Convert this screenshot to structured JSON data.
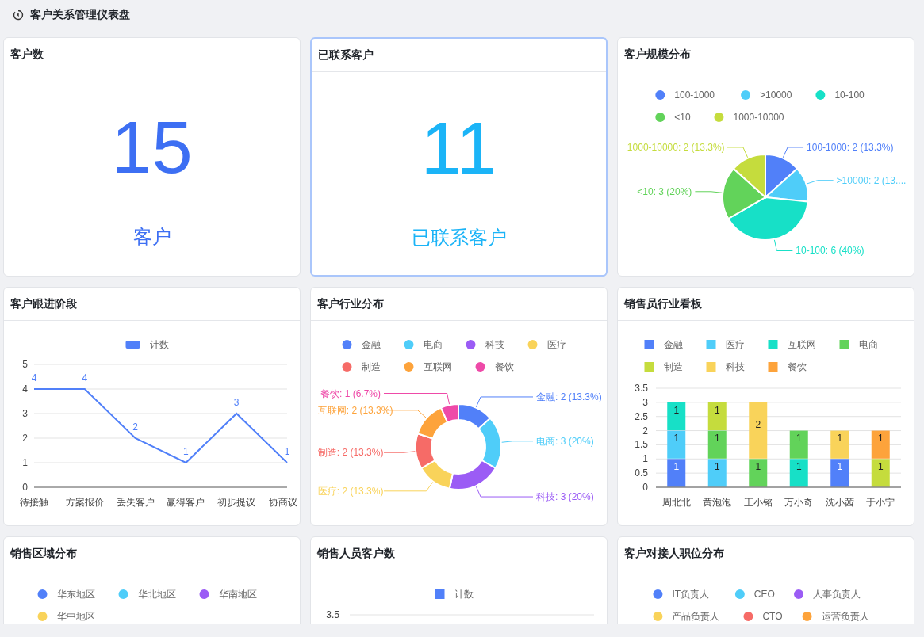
{
  "header": {
    "title": "客户关系管理仪表盘"
  },
  "cards": [
    {
      "kind": "stat",
      "title": "客户数",
      "value": "15",
      "label": "客户",
      "color": "#3d6ff3",
      "highlighted": false
    },
    {
      "kind": "stat",
      "title": "已联系客户",
      "value": "11",
      "label": "已联系客户",
      "color": "#1bb4f7",
      "highlighted": true
    },
    {
      "kind": "chart",
      "title": "客户规模分布",
      "chart_data": {
        "type": "pie",
        "legend": "top",
        "categories": [
          "100-1000",
          ">10000",
          "10-100",
          "<10",
          "1000-10000"
        ],
        "values": [
          2,
          2,
          6,
          3,
          2
        ],
        "colors": [
          "#5180f9",
          "#4fcdf9",
          "#17e0c7",
          "#62d35a",
          "#c5dc3d"
        ],
        "value_labels": [
          "100-1000: 2 (13.3%)",
          ">10000: 2 (13....",
          "10-100: 6 (40%)",
          "<10: 3 (20%)",
          "1000-10000: 2 (13.3%)"
        ]
      }
    },
    {
      "kind": "chart",
      "title": "客户跟进阶段",
      "chart_data": {
        "type": "line",
        "legend": "top",
        "grid": true,
        "categories": [
          "待接触",
          "方案报价",
          "丢失客户",
          "赢得客户",
          "初步提议",
          "协商议"
        ],
        "series": [
          {
            "name": "计数",
            "color": "#5180f9",
            "values": [
              4,
              4,
              2,
              1,
              3,
              1
            ]
          }
        ],
        "ylim": [
          0,
          5
        ],
        "yticks": [
          0,
          1,
          2,
          3,
          4,
          5
        ],
        "data_labels": true
      }
    },
    {
      "kind": "chart",
      "title": "客户行业分布",
      "chart_data": {
        "type": "donut",
        "legend": "top",
        "categories": [
          "金融",
          "电商",
          "科技",
          "医疗",
          "制造",
          "互联网",
          "餐饮"
        ],
        "values": [
          2,
          3,
          3,
          2,
          2,
          2,
          1
        ],
        "colors": [
          "#5180f9",
          "#4fcdf9",
          "#9b5cf5",
          "#f9d35a",
          "#f66b67",
          "#fda33b",
          "#ee4aa8"
        ],
        "value_labels": [
          "金融: 2 (13.3%)",
          "电商: 3 (20%)",
          "科技: 3 (20%)",
          "医疗: 2 (13.3%)",
          "制造: 2 (13.3%)",
          "互联网: 2 (13.3%)",
          "餐饮: 1 (6.7%)"
        ]
      }
    },
    {
      "kind": "chart",
      "title": "销售员行业看板",
      "chart_data": {
        "type": "bar",
        "legend": "top",
        "grid": true,
        "stacked": true,
        "categories": [
          "周北北",
          "黄泡泡",
          "王小铭",
          "万小奇",
          "沈小茜",
          "于小宁"
        ],
        "series": [
          {
            "name": "金融",
            "color": "#5180f9",
            "values": [
              1,
              null,
              null,
              null,
              1,
              null
            ]
          },
          {
            "name": "医疗",
            "color": "#4fcdf9",
            "values": [
              1,
              1,
              null,
              null,
              null,
              null
            ]
          },
          {
            "name": "互联网",
            "color": "#17e0c7",
            "values": [
              1,
              null,
              null,
              1,
              null,
              null
            ]
          },
          {
            "name": "电商",
            "color": "#62d35a",
            "values": [
              null,
              1,
              1,
              1,
              null,
              null
            ]
          },
          {
            "name": "制造",
            "color": "#c5dc3d",
            "values": [
              null,
              1,
              null,
              null,
              null,
              1
            ]
          },
          {
            "name": "科技",
            "color": "#f9d35a",
            "values": [
              null,
              null,
              2,
              null,
              1,
              null
            ]
          },
          {
            "name": "餐饮",
            "color": "#fda33b",
            "values": [
              null,
              null,
              null,
              null,
              null,
              1
            ]
          }
        ],
        "ylim": [
          0,
          3.5
        ],
        "yticks": [
          0,
          0.5,
          1,
          1.5,
          2,
          2.5,
          3,
          3.5
        ],
        "data_labels": true
      }
    },
    {
      "kind": "dot_legend",
      "title": "销售区域分布",
      "legend": [
        {
          "label": "华东地区",
          "color": "#5180f9"
        },
        {
          "label": "华北地区",
          "color": "#4fcdf9"
        },
        {
          "label": "华南地区",
          "color": "#9b5cf5"
        },
        {
          "label": "华中地区",
          "color": "#f9d35a"
        }
      ]
    },
    {
      "kind": "square_legend",
      "title": "销售人员客户数",
      "legend": [
        {
          "label": "计数",
          "color": "#5180f9"
        }
      ],
      "axis_labels": [
        "3.5"
      ]
    },
    {
      "kind": "dot_legend",
      "title": "客户对接人职位分布",
      "legend": [
        {
          "label": "IT负责人",
          "color": "#5180f9"
        },
        {
          "label": "CEO",
          "color": "#4fcdf9"
        },
        {
          "label": "人事负责人",
          "color": "#9b5cf5"
        },
        {
          "label": "产品负责人",
          "color": "#f9d35a"
        },
        {
          "label": "CTO",
          "color": "#f66b67"
        },
        {
          "label": "运营负责人",
          "color": "#fda33b"
        }
      ]
    }
  ]
}
